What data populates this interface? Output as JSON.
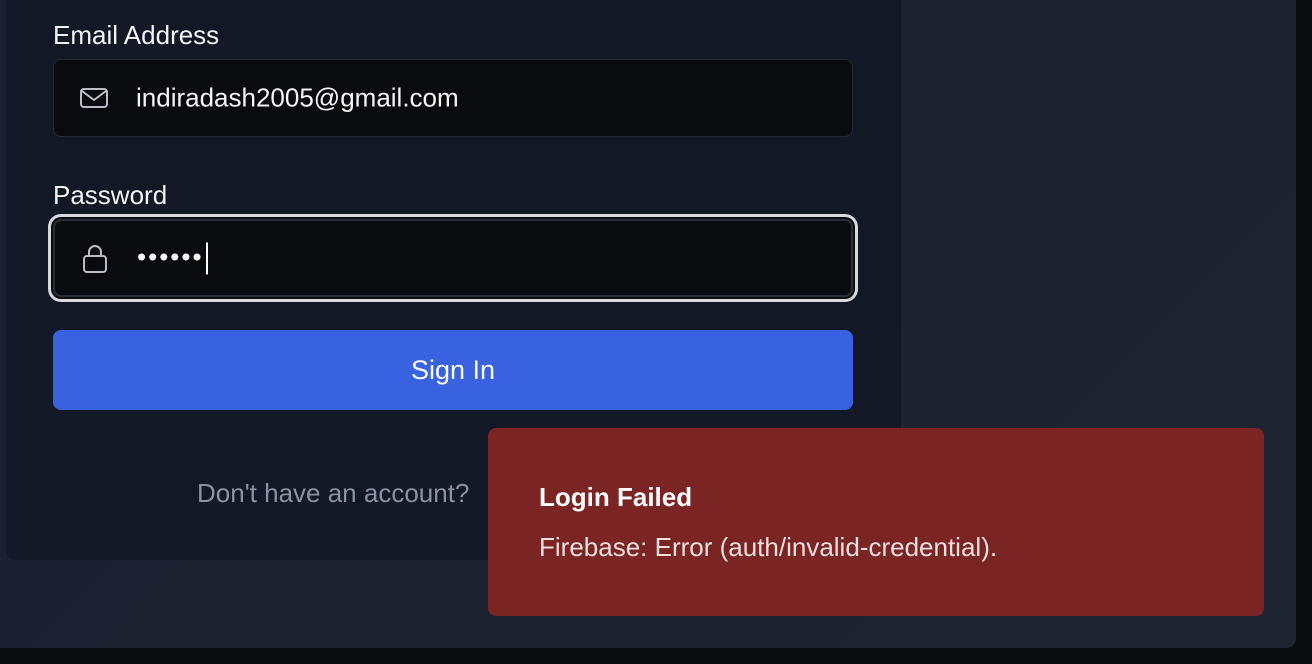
{
  "login_form": {
    "email_label": "Email Address",
    "email_value": "indiradash2005@gmail.com",
    "password_label": "Password",
    "password_value_masked": "••••••",
    "signin_label": "Sign In",
    "signup_prompt": "Don't have an account?"
  },
  "toast": {
    "title": "Login Failed",
    "message": "Firebase: Error (auth/invalid-credential)."
  },
  "colors": {
    "primary_button": "#3862e0",
    "toast_error": "#7a2424",
    "card_bg": "#121826",
    "input_bg": "#0a0b0e"
  },
  "icons": {
    "email": "mail-icon",
    "password": "lock-icon"
  }
}
